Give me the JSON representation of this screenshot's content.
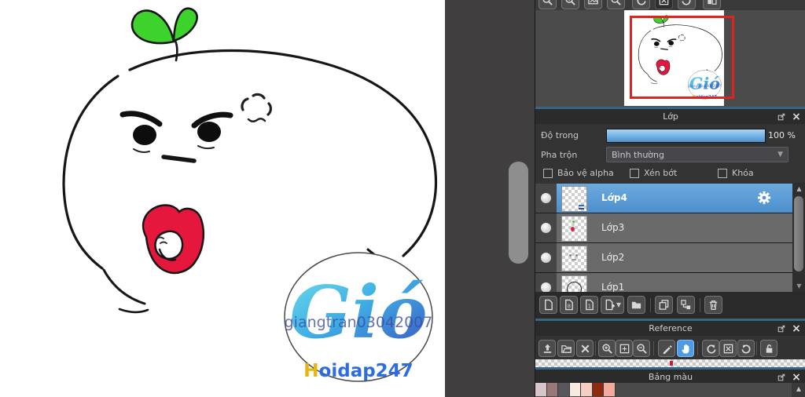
{
  "canvas": {
    "watermark": {
      "logo": "Gió",
      "signature": "giangtran03042007",
      "site_first": "H",
      "site_rest": "oidap247"
    }
  },
  "navigator": {
    "toolbar_icons": [
      "zoom-out",
      "zoom-in",
      "fit-view",
      "zoom-reset",
      "rotate-left",
      "reset-rotation",
      "rotate-right",
      "compare-view"
    ]
  },
  "layer_panel": {
    "title": "Lớp",
    "opacity_label": "Độ trong",
    "opacity_percent": 100,
    "opacity_value": "100 %",
    "blend_label": "Pha trộn",
    "blend_mode": "Bình thường",
    "checkbox_alpha": "Bảo vệ alpha",
    "checkbox_clip": "Xén bớt",
    "checkbox_lock": "Khóa",
    "layers": [
      {
        "name": "Lớp4",
        "selected": true
      },
      {
        "name": "Lớp3",
        "selected": false
      },
      {
        "name": "Lớp2",
        "selected": false
      },
      {
        "name": "Lớp1",
        "selected": false
      }
    ],
    "toolbar_icons": [
      "new-layer",
      "new-8bit-layer",
      "new-1bit-layer",
      "add-layer-menu",
      "new-folder",
      "duplicate-layer",
      "merge-layer",
      "delete-layer"
    ]
  },
  "reference_panel": {
    "title": "Reference",
    "toolbar_icons": [
      "import-image",
      "open-folder",
      "clear",
      "zoom-in",
      "fit-view",
      "zoom-out",
      "color-picker",
      "hand",
      "rotate-left",
      "reset-view",
      "rotate-right",
      "lock"
    ],
    "active_tool": "hand"
  },
  "palette_panel": {
    "title": "Bảng màu",
    "swatches": [
      "#d6c6ca",
      "#9b7878",
      "#57575b",
      "#f9eadf",
      "#f6cfc1",
      "#8d2b10",
      "#f1ac9e"
    ]
  },
  "colors": {
    "selection_highlight": "#5b9bd8",
    "navigator_selection_rect": "#df241f",
    "slider_fill": "#6fb3e8"
  }
}
